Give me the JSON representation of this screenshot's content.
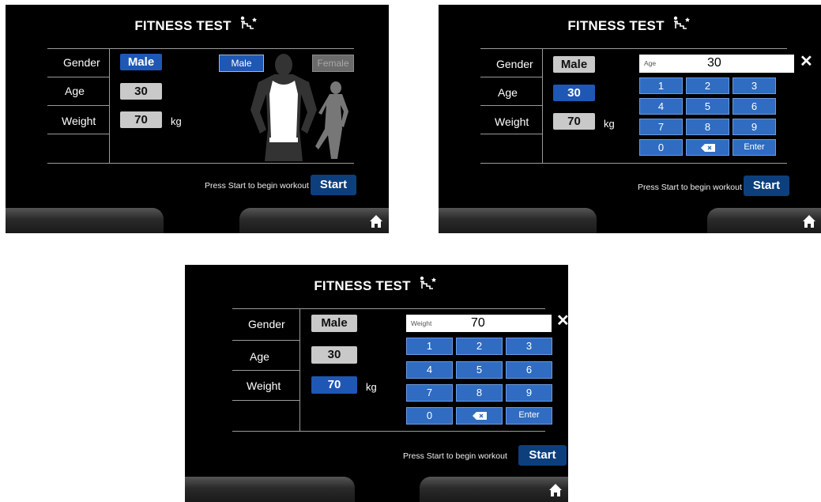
{
  "app": {
    "title": "FITNESS TEST",
    "title_icon": "stairs-icon"
  },
  "form": {
    "gender_label": "Gender",
    "age_label": "Age",
    "weight_label": "Weight",
    "gender_value": "Male",
    "age_value": "30",
    "weight_value": "70",
    "weight_unit": "kg"
  },
  "gender_picker": {
    "male_label": "Male",
    "female_label": "Female"
  },
  "keypad": {
    "age_display_label": "Age",
    "age_display_value": "30",
    "weight_display_label": "Weight",
    "weight_display_value": "70",
    "close_icon": "close-icon",
    "keys": [
      "1",
      "2",
      "3",
      "4",
      "5",
      "6",
      "7",
      "8",
      "9",
      "0",
      "",
      "Enter"
    ],
    "backspace_icon": "backspace-icon"
  },
  "footer": {
    "prompt": "Press Start to begin workout",
    "start_label": "Start",
    "home_icon": "home-icon"
  },
  "colors": {
    "background": "#000000",
    "active": "#1f57b5",
    "inactive": "#c9c9c9",
    "start": "#0d3f7d",
    "key": "#2f6cc2"
  }
}
